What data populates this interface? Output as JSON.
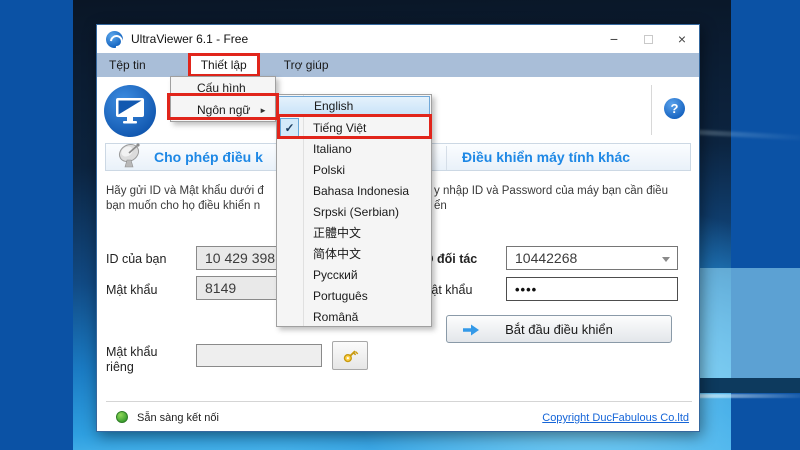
{
  "window": {
    "title": "UltraViewer 6.1 - Free"
  },
  "icons": {
    "minimize": "−",
    "close": "×",
    "help": "?",
    "check": "✓",
    "submenu_arrow": "►"
  },
  "menubar": {
    "file": "Tệp tin",
    "settings": "Thiết lập",
    "help": "Trợ giúp"
  },
  "menus": {
    "settings_menu": {
      "config": "Cấu hình",
      "language": "Ngôn ngữ"
    },
    "language_submenu": {
      "items": [
        {
          "label": "English",
          "state": "hovered"
        },
        {
          "label": "Tiếng Việt",
          "state": "checked"
        },
        {
          "label": "Italiano",
          "state": ""
        },
        {
          "label": "Polski",
          "state": ""
        },
        {
          "label": "Bahasa Indonesia",
          "state": ""
        },
        {
          "label": "Srpski (Serbian)",
          "state": ""
        },
        {
          "label": "正體中文",
          "state": ""
        },
        {
          "label": "简体中文",
          "state": ""
        },
        {
          "label": "Русский",
          "state": ""
        },
        {
          "label": "Português",
          "state": ""
        },
        {
          "label": "Română",
          "state": ""
        }
      ]
    }
  },
  "panels": {
    "local": {
      "header": "Cho phép điều k",
      "description_line1": "Hãy gửi ID và Mật khẩu dưới đ",
      "description_line2": "bạn muốn cho họ điều khiển n",
      "id_label": "ID của bạn",
      "id_value": "10 429 398",
      "password_label": "Mật khẩu",
      "password_value": "8149",
      "private_password_label_line1": "Mật khẩu",
      "private_password_label_line2": "riêng",
      "private_password_value": ""
    },
    "remote": {
      "header": "Điều khiển máy tính khác",
      "description_line1": "y nhập ID và Password của máy bạn cần điều",
      "description_line2": "ển",
      "partner_id_label": "ID đối tác",
      "partner_id_value": "10442268",
      "password_label": "Mật khẩu",
      "password_value": "••••",
      "connect_button": "Bắt đầu điều khiển"
    }
  },
  "statusbar": {
    "status": "Sẵn sàng kết nối",
    "copyright": "Copyright DucFabulous Co.ltd"
  },
  "colors": {
    "annotation_red": "#e1251b",
    "accent_blue": "#1e88e5",
    "menubar_bg": "#a9bed8",
    "status_green": "#3a9e2f",
    "link_blue": "#1565d8"
  }
}
